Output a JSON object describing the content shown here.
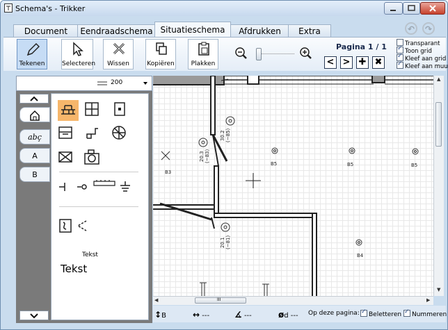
{
  "window": {
    "title": "Schema's - Trikker"
  },
  "tabs": [
    {
      "label": "Document",
      "active": false
    },
    {
      "label": "Eendraadschema",
      "active": false
    },
    {
      "label": "Situatieschema",
      "active": true
    },
    {
      "label": "Afdrukken",
      "active": false
    },
    {
      "label": "Extra",
      "active": false
    }
  ],
  "ribbon": {
    "tools": [
      {
        "label": "Tekenen",
        "icon": "pencil-icon",
        "active": true
      },
      {
        "label": "Selecteren",
        "icon": "cursor-icon",
        "active": false
      },
      {
        "label": "Wissen",
        "icon": "erase-icon",
        "active": false
      },
      {
        "label": "Kopiëren",
        "icon": "copy-icon",
        "active": false
      },
      {
        "label": "Plakken",
        "icon": "paste-icon",
        "active": false
      }
    ],
    "page_label": "Pagina 1 / 1",
    "checkboxes": [
      {
        "label": "Transparant",
        "checked": false
      },
      {
        "label": "Toon grid",
        "checked": true
      },
      {
        "label": "Kleef aan grid",
        "checked": true
      },
      {
        "label": "Kleef aan muur",
        "checked": true
      }
    ]
  },
  "zoom": {
    "value": "200"
  },
  "side_tabs": [
    "",
    "abç",
    "A",
    "B"
  ],
  "palette": {
    "text_small": "Tekst",
    "text_large": "Tekst"
  },
  "canvas_labels": {
    "b3": "B3",
    "b5a": "B5",
    "b5b": "B5",
    "b5c": "B5",
    "b4": "B4",
    "dim1": "30.2",
    "dim1b": "(~85)",
    "dim2": "20.3",
    "dim2b": "(~83)",
    "dim3": "20.1",
    "dim3b": "(~81)"
  },
  "scroll_marker": "III",
  "status": {
    "b_label": "B",
    "arrow_text": "---",
    "angle_text": "---",
    "phi_label": "d",
    "phi_text": "---",
    "page_label": "Op deze pagina:",
    "beletteren": "Beletteren",
    "nummeren": "Nummeren",
    "beletteren_checked": true,
    "nummeren_checked": true
  }
}
